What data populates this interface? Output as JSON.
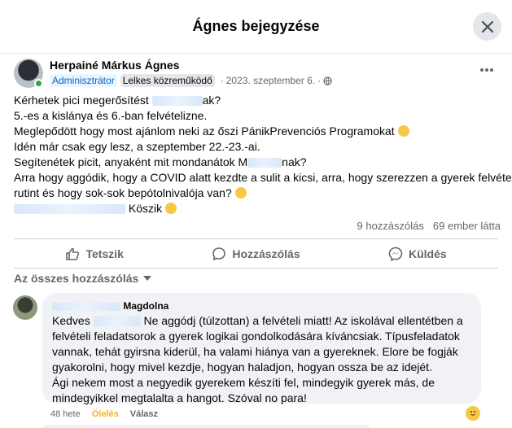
{
  "modal": {
    "title": "Ágnes bejegyzése"
  },
  "post": {
    "author": "Herpainé Márkus Ágnes",
    "badge_admin": "Adminisztrátor",
    "badge_contributor": "Lelkes közreműködő",
    "date": "2023. szeptember 6.",
    "lines": [
      {
        "pre": "Kérhetek pici megerősítést ",
        "post": "ak?"
      },
      {
        "pre": "5.-es a kislánya és 6.-ban felvételizne.",
        "post": ""
      },
      {
        "pre": "Meglepődött hogy most ajánlom neki az őszi PánikPrevenciós Programokat",
        "post": ""
      },
      {
        "pre": "Idén már csak egy lesz, a szeptember 22.-23.-ai.",
        "post": ""
      },
      {
        "pre": "Segítenétek picit, anyaként mit mondanátok M",
        "post": "nak?"
      },
      {
        "pre": "Arra hogy aggódik, hogy a COVID alatt kezdte a sulit a kicsi, arra, hogy szerezzen a gyerek felvételi",
        "post": ""
      },
      {
        "pre": "rutint és hogy sok-sok bepótolnivalója van?",
        "post": ""
      }
    ],
    "mention_suffix": "Köszik",
    "comment_count": "9 hozzászólás",
    "views": "69 ember látta"
  },
  "actions": {
    "like": "Tetszik",
    "comment": "Hozzászólás",
    "share": "Küldés"
  },
  "filter_label": "Az összes hozzászólás",
  "comment": {
    "author_visible": "Magdolna",
    "greeting_pre": "Kedves ",
    "lines": [
      "Ne aggódj (túlzottan) a felvételi miatt! Az iskolával ellentétben a",
      "felvételi feladatsorok a gyerek logikai gondolkodására kíváncsiak. Típusfeladatok",
      "vannak, tehát gyirsna kiderül, ha valami hiánya van a gyereknek. Elore be fogják",
      "gyakorolni, hogy mivel kezdje, hogyan haladjon, hogyan ossza be az idejét.",
      "Ági nekem most a negyedik gyerekem készíti fel, mindegyik gyerek más, de",
      "mindegyikkel megtalalta a hangot. Szóval no para!"
    ],
    "age": "48 hete",
    "like": "Ölelés",
    "reply": "Válasz"
  },
  "colors": {
    "accent": "#0064d1",
    "like_orange": "#f7b125",
    "online": "#31a24c"
  }
}
